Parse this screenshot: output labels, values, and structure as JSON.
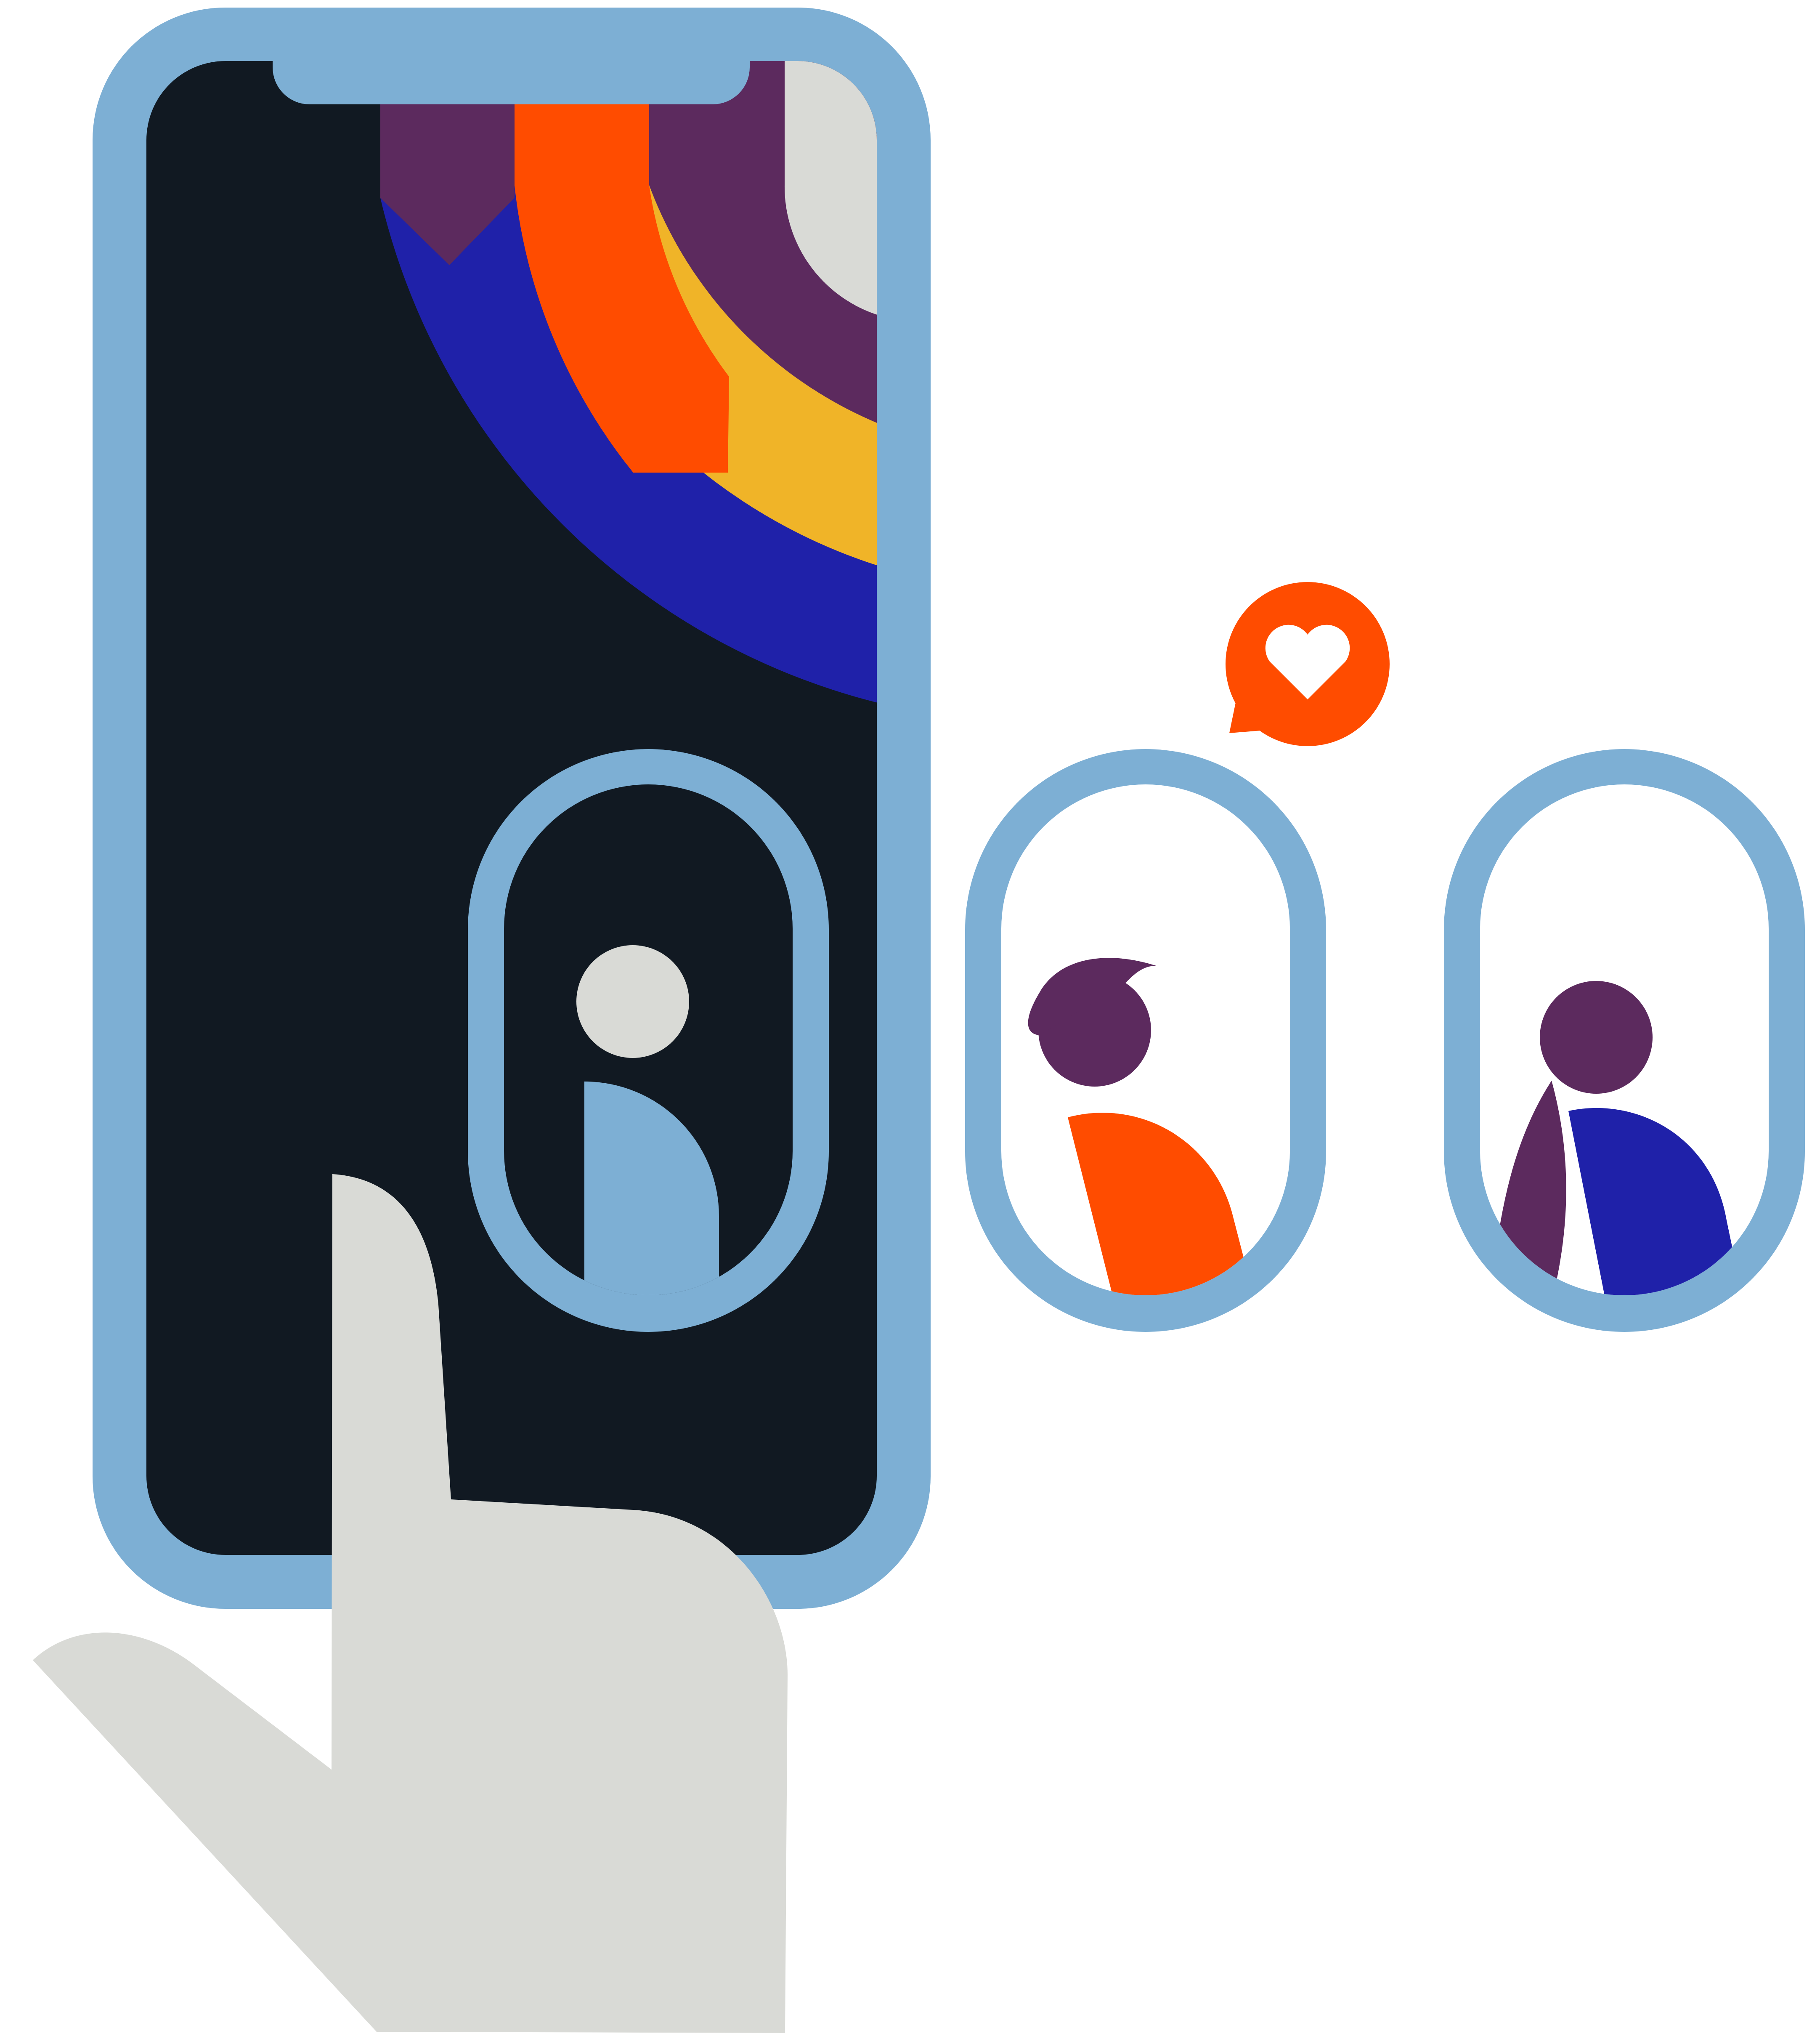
{
  "illustration": {
    "phone": {
      "frame_color": "#7DAFD4",
      "screen_color": "#111922",
      "camera_notch": "notch"
    },
    "rainbow_arcs": {
      "colors": {
        "purple": "#5C2A5E",
        "orange": "#FF4C00",
        "blue": "#1F21A9",
        "yellow": "#F0B428",
        "light_gray": "#D9DAD6"
      }
    },
    "profile_cards": [
      {
        "name": "self-profile",
        "head_color": "#D9DAD6",
        "body_color": "#7DAFD4",
        "active": true
      },
      {
        "name": "match-profile-1",
        "head_color": "#5C2A5E",
        "body_color": "#FF4C00",
        "active": false
      },
      {
        "name": "match-profile-2",
        "head_color": "#5C2A5E",
        "body_color": "#1F21A9",
        "active": false
      }
    ],
    "reaction": {
      "icon": "heart-icon",
      "bubble_color": "#FF4C00",
      "heart_color": "#FFFFFF"
    },
    "hand": {
      "color": "#D9DAD6",
      "gesture": "pointing-finger-tap"
    },
    "card_outline_color": "#7DAFD4",
    "card_fill_color": "#FFFFFF"
  }
}
